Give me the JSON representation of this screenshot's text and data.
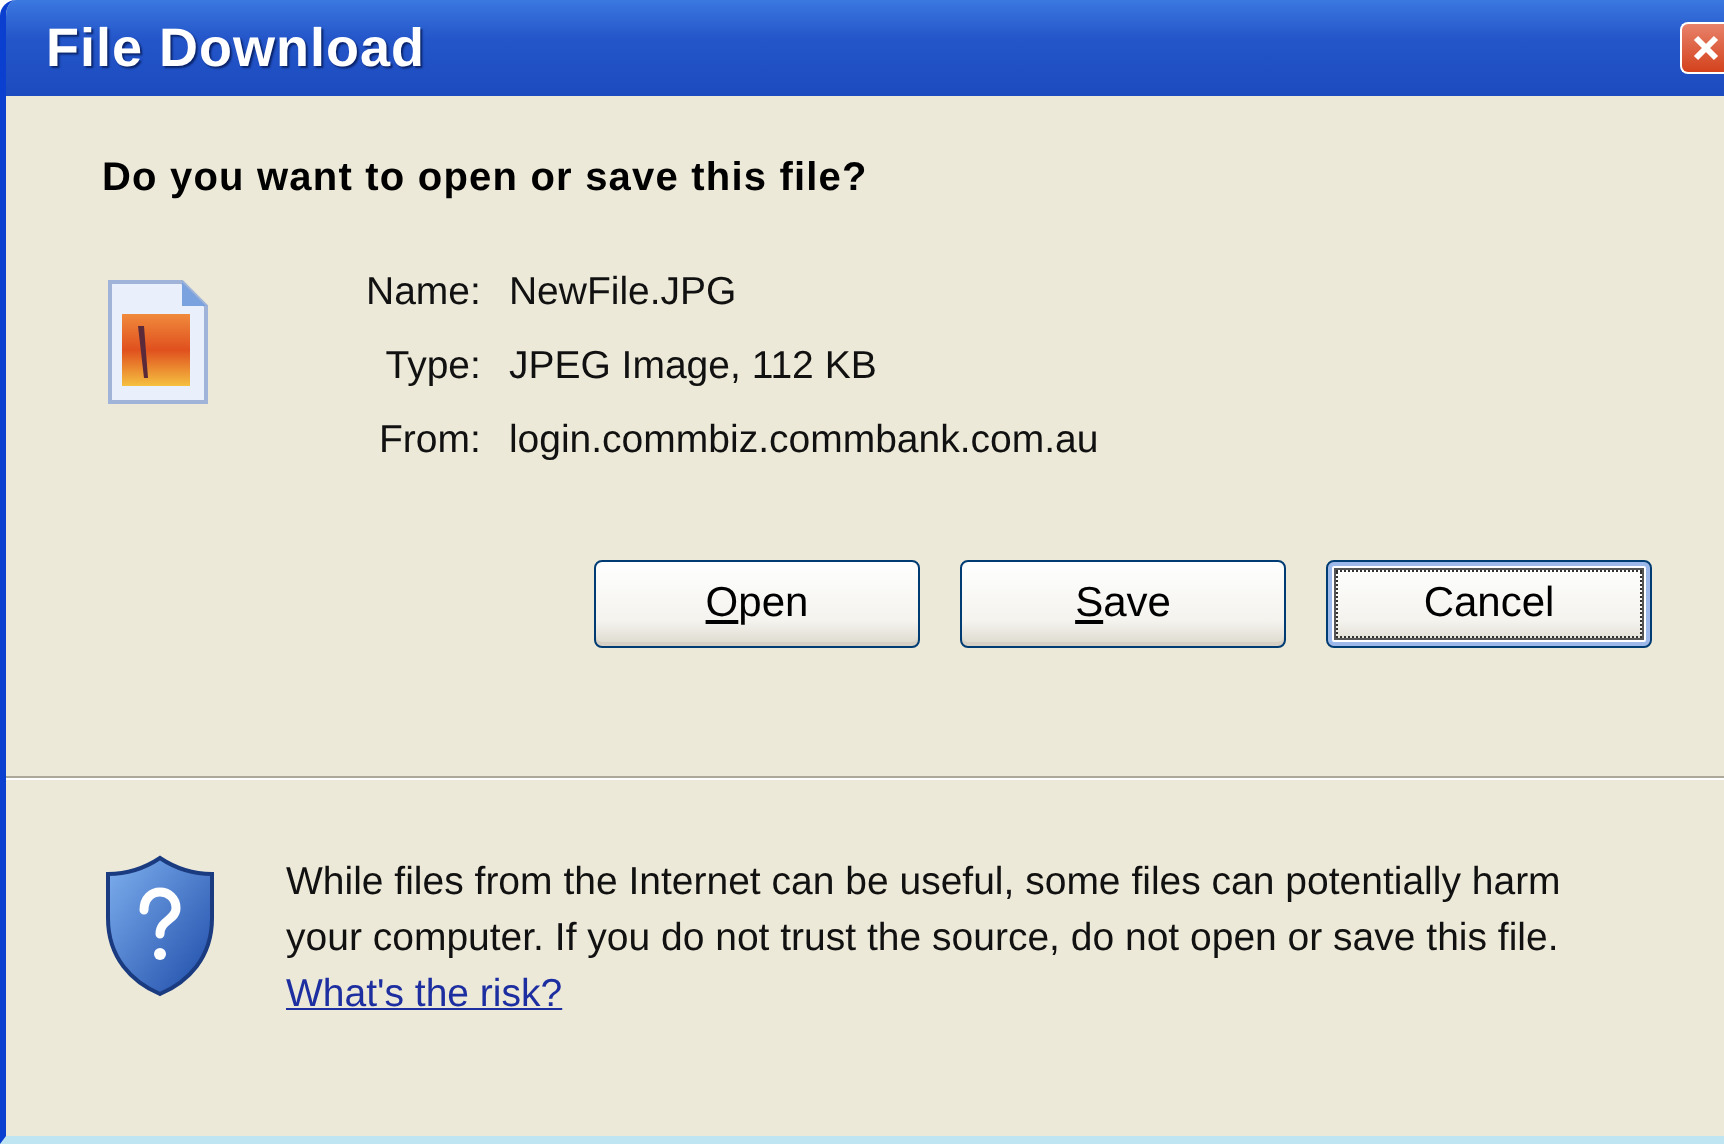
{
  "window": {
    "title": "File Download"
  },
  "question": "Do you want to open or save this file?",
  "fields": [
    {
      "label": "Name:",
      "value": "NewFile.JPG"
    },
    {
      "label": "Type:",
      "value": "JPEG Image, 112 KB"
    },
    {
      "label": "From:",
      "value": "login.commbiz.commbank.com.au"
    }
  ],
  "buttons": [
    {
      "kind": "mnemonic",
      "access_key": "O",
      "label_rest": "pen",
      "focused": false
    },
    {
      "kind": "mnemonic",
      "access_key": "S",
      "label_rest": "ave",
      "focused": false
    },
    {
      "kind": "plain",
      "label": "Cancel",
      "focused": true
    }
  ],
  "warning": {
    "text": "While files from the Internet can be useful, some files can potentially harm your computer. If you do not trust the source, do not open or save this file.",
    "link": "What's the risk?"
  }
}
